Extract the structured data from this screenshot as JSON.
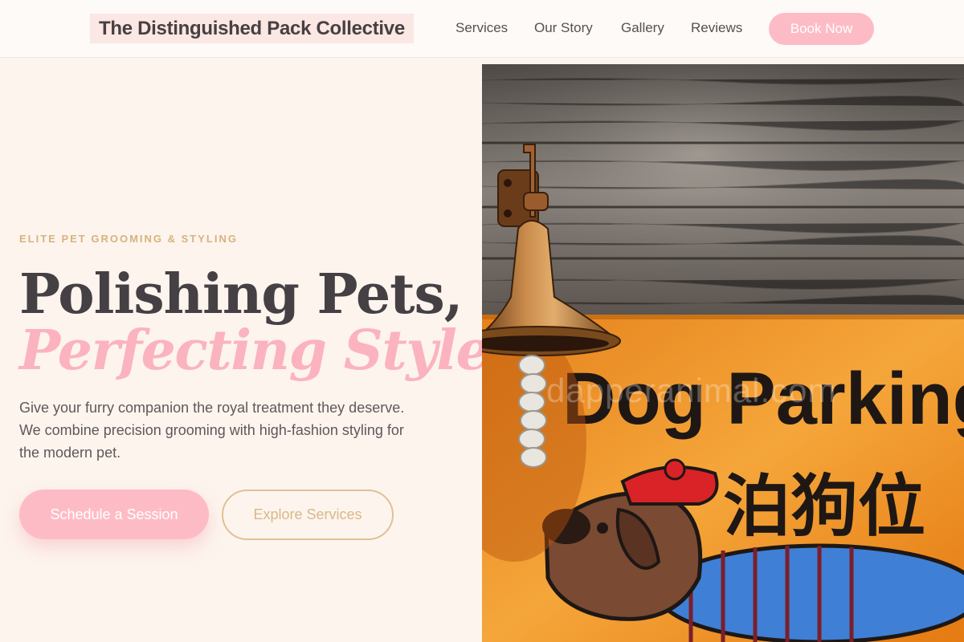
{
  "brand": {
    "name": "The Distinguished Pack Collective"
  },
  "nav": {
    "links": [
      "Services",
      "Our Story",
      "Gallery",
      "Reviews"
    ],
    "cta": "Book Now"
  },
  "hero": {
    "eyebrow": "ELITE PET GROOMING & STYLING",
    "headline_line1": "Polishing Pets,",
    "headline_line2": "Perfecting Style.",
    "lead": "Give your furry companion the royal treatment they deserve. We combine precision grooming with high-fashion styling for the modern pet.",
    "primary_cta": "Schedule a Session",
    "secondary_cta": "Explore Services"
  },
  "image": {
    "sign_text_en": "Dog Parking",
    "sign_text_zh": "泊狗位",
    "watermark": "dapperanimal.com"
  },
  "colors": {
    "accent_pink": "#fdbcc5",
    "accent_gold": "#d6b37c",
    "text_dark": "#444043",
    "background": "#fdf4ee"
  }
}
